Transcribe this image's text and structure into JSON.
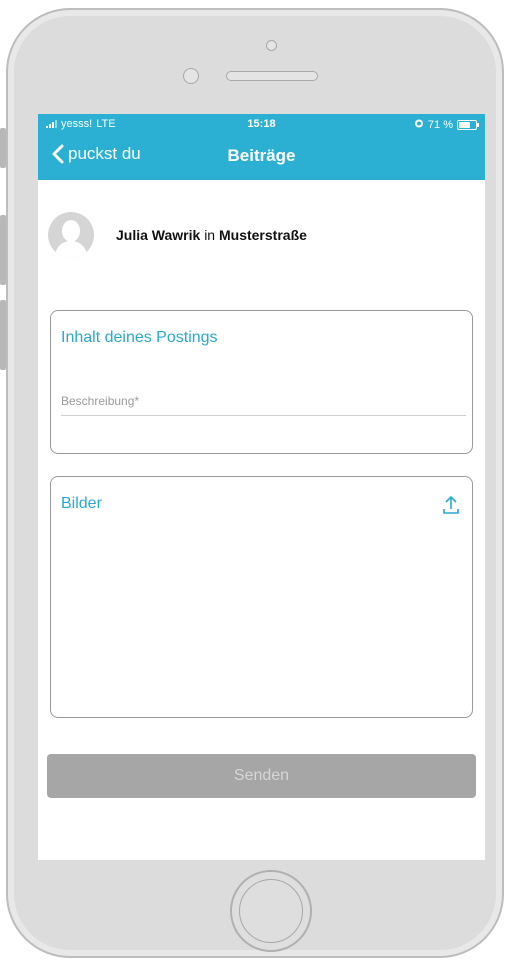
{
  "status_bar": {
    "carrier": "yesss!",
    "network": "LTE",
    "time": "15:18",
    "battery_text": "71 %",
    "battery_level": 0.71
  },
  "nav": {
    "back_label": "puckst du",
    "title": "Beiträge"
  },
  "author": {
    "name": "Julia Wawrik",
    "connector": "in",
    "location": "Musterstraße"
  },
  "content_card": {
    "title": "Inhalt deines Postings",
    "description_placeholder": "Beschreibung*",
    "description_value": ""
  },
  "images_card": {
    "title": "Bilder",
    "upload_icon": "upload-icon"
  },
  "send_button": {
    "label": "Senden"
  },
  "colors": {
    "accent": "#2bb0d4",
    "disabled_button": "#a6a6a6",
    "frame": "#dcdcdc"
  }
}
